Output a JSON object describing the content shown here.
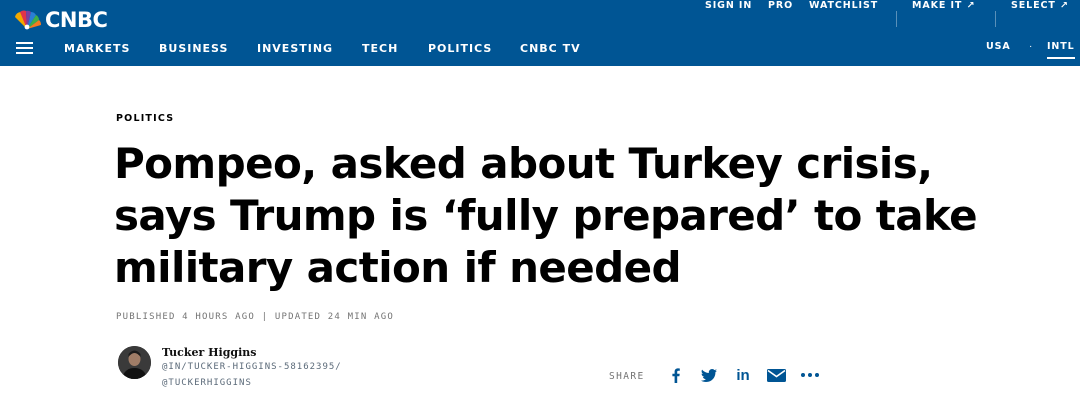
{
  "header": {
    "brand": "CNBC",
    "top_links": {
      "sign_in": "SIGN IN",
      "pro": "PRO",
      "watchlist": "WATCHLIST",
      "make_it": "MAKE IT ↗",
      "select": "SELECT ↗"
    },
    "nav": [
      "MARKETS",
      "BUSINESS",
      "INVESTING",
      "TECH",
      "POLITICS",
      "CNBC TV"
    ],
    "editions": {
      "usa": "USA",
      "intl": "INTL",
      "separator": "·"
    },
    "colors": {
      "bar": "#005594",
      "text": "#ffffff"
    }
  },
  "article": {
    "kicker": "POLITICS",
    "headline": "Pompeo, asked about Turkey crisis, says Trump is ‘fully prepared’ to take military action if needed",
    "timestamps": "PUBLISHED 4 HOURS AGO | UPDATED 24 MIN AGO"
  },
  "author": {
    "name": "Tucker Higgins",
    "linkedin": "@IN/TUCKER-HIGGINS-58162395/",
    "twitter": "@TUCKERHIGGINS"
  },
  "share": {
    "label": "SHARE",
    "icons": [
      "facebook-icon",
      "twitter-icon",
      "linkedin-icon",
      "email-icon",
      "more-icon"
    ],
    "linkedin_glyph": "in",
    "icon_color": "#005594"
  }
}
